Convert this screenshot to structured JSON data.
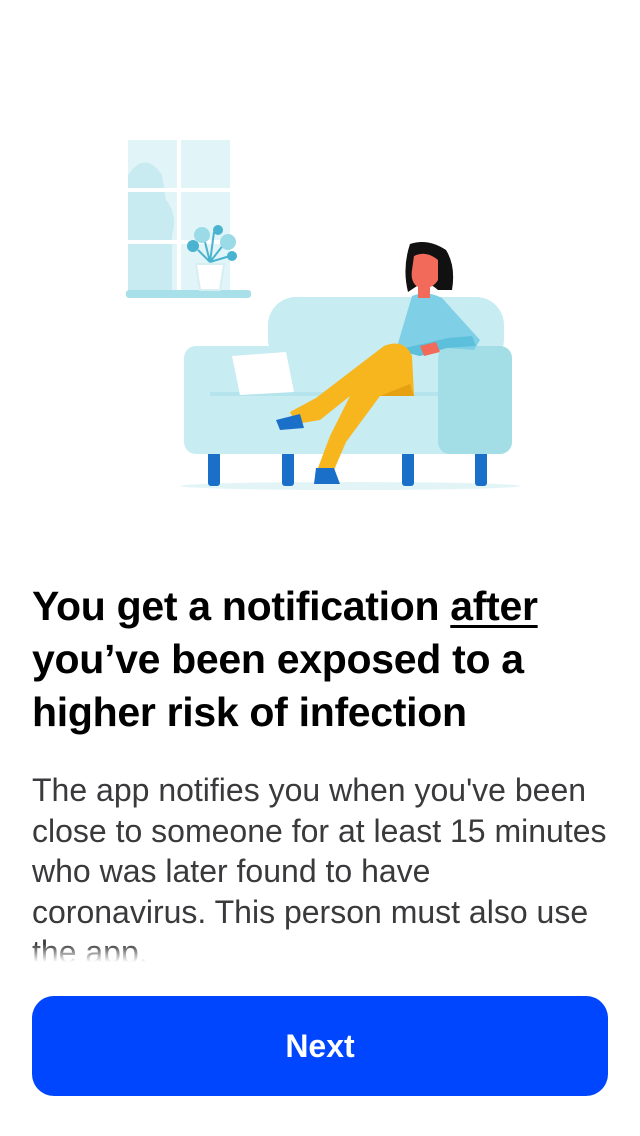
{
  "onboarding": {
    "title_part1": "You get a notification ",
    "title_emphasis": "after",
    "title_part2": " you’ve been exposed to a higher risk of infection",
    "body": "The app notifies you when you've been close to someone for at least 15 minutes who was later found to have coronavirus. This person must also use the app.",
    "next_label": "Next"
  },
  "colors": {
    "primary": "#0046ff",
    "sofa": "#c7ecf2",
    "sofa_shadow": "#a3dde6",
    "sofa_legs": "#1a6fc9",
    "pants": "#f7b51e",
    "top": "#7fd0e6",
    "skin": "#f26a5a",
    "hair": "#111111"
  },
  "illustration": {
    "icon": "woman-on-sofa-illustration"
  }
}
